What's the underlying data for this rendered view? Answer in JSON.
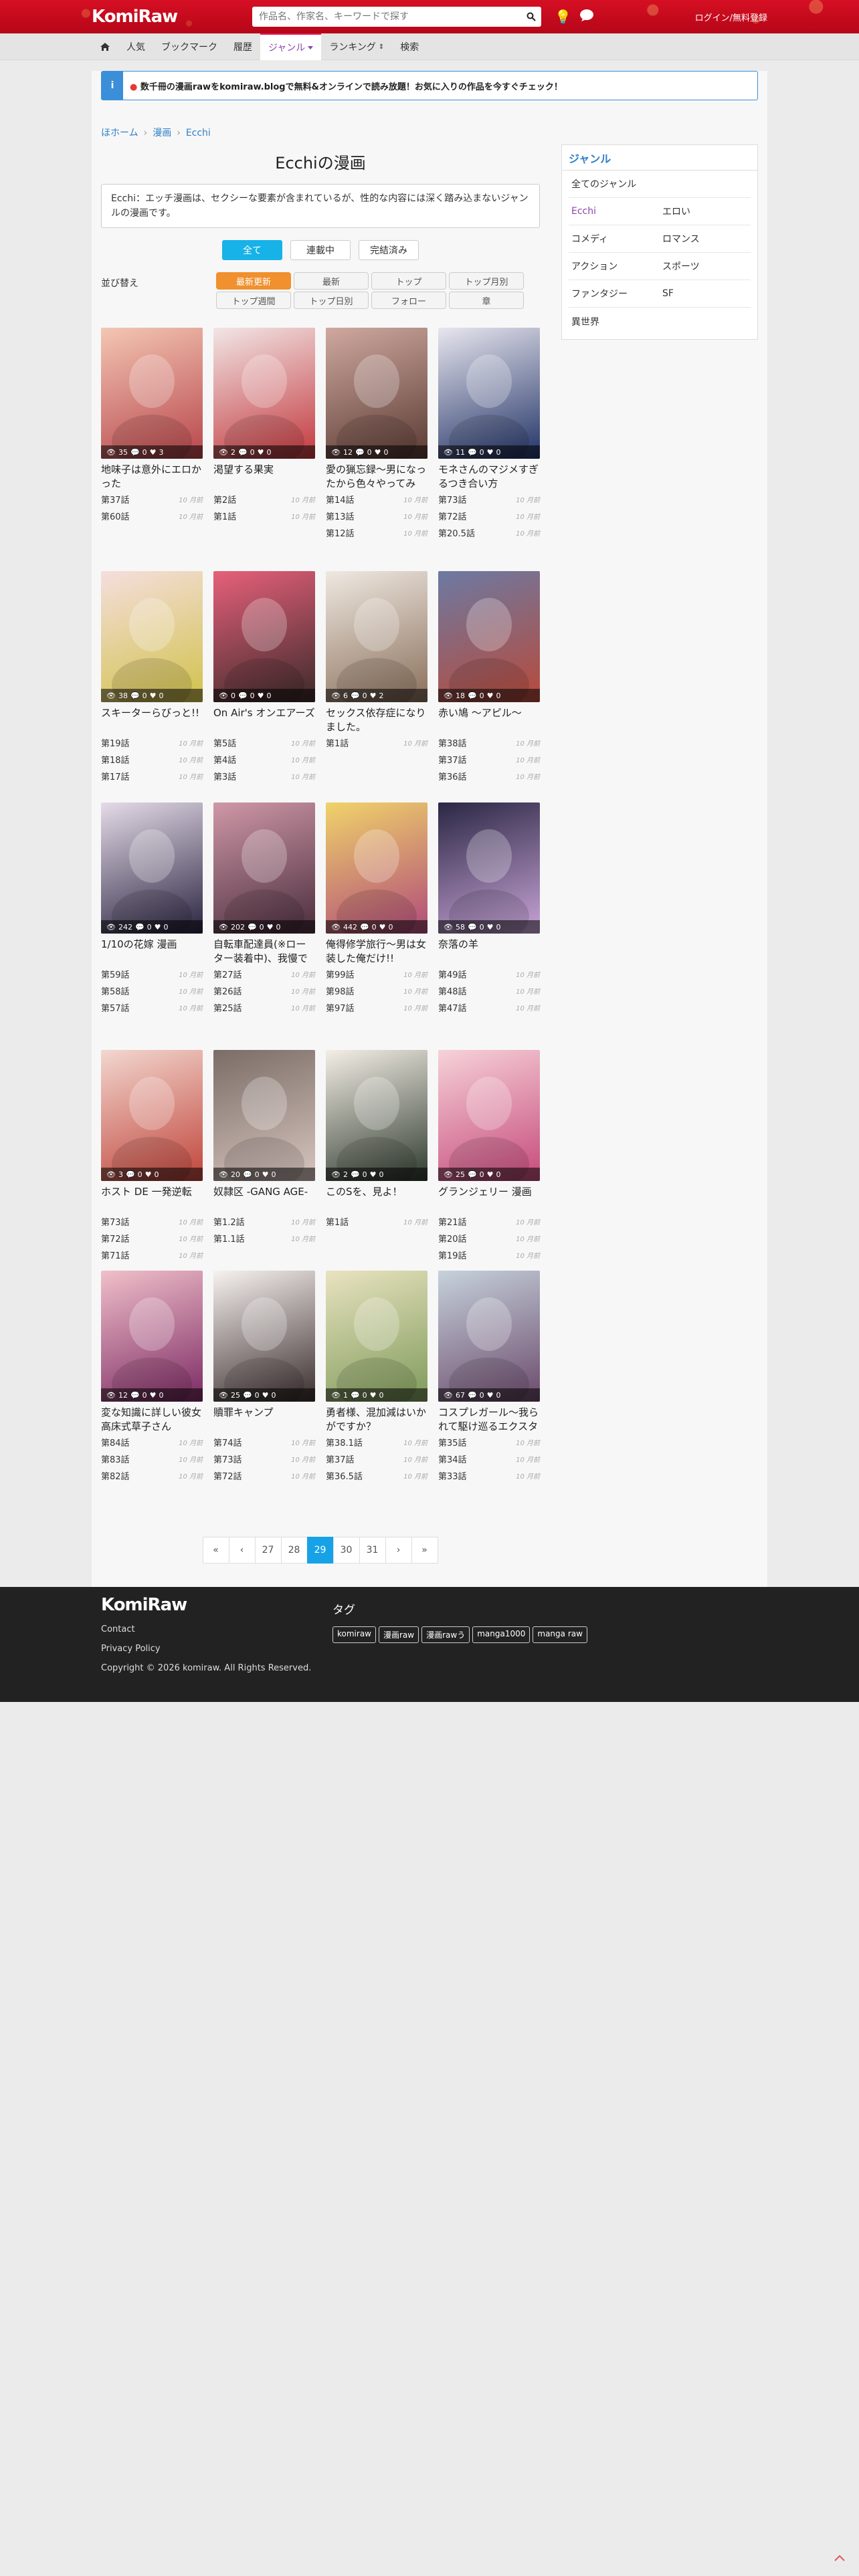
{
  "header": {
    "logo": "KomiRaw",
    "search_placeholder": "作品名、作家名、キーワードで探す",
    "login": "ログイン/無料登録"
  },
  "nav": {
    "home_icon": "home-icon",
    "items": [
      "人気",
      "ブックマーク",
      "履歴",
      "ジャンル",
      "ランキング",
      "検索"
    ]
  },
  "notice": {
    "icon_text": "i",
    "text": "数千冊の漫画rawをkomiraw.blogで無料&オンラインで読み放題！お気に入りの作品を今すぐチェック！"
  },
  "breadcrumb": [
    "ほホーム",
    "漫画",
    "Ecchi"
  ],
  "page": {
    "title": "Ecchiの漫画",
    "description": "Ecchi：エッチ漫画は、セクシーな要素が含まれているが、性的な内容には深く踏み込まないジャンルの漫画です。"
  },
  "status_tabs": [
    "全て",
    "連載中",
    "完結済み"
  ],
  "sort": {
    "label": "並び替え",
    "options": [
      "最新更新",
      "最新",
      "トップ",
      "トップ月別",
      "トップ週間",
      "トップ日別",
      "フォロー",
      "章"
    ]
  },
  "manga": [
    {
      "title": "地味子は意外にエロかった",
      "views": "35",
      "comments": "0",
      "likes": "3",
      "chapters": [
        {
          "ch": "第37話",
          "ago": "10 月前"
        },
        {
          "ch": "第60話",
          "ago": "10 月前"
        }
      ]
    },
    {
      "title": "渇望する果実",
      "views": "2",
      "comments": "0",
      "likes": "0",
      "chapters": [
        {
          "ch": "第2話",
          "ago": "10 月前"
        },
        {
          "ch": "第1話",
          "ago": "10 月前"
        }
      ]
    },
    {
      "title": "愛の猟忘録〜男になったから色々やってみた〜",
      "views": "12",
      "comments": "0",
      "likes": "0",
      "chapters": [
        {
          "ch": "第14話",
          "ago": "10 月前"
        },
        {
          "ch": "第13話",
          "ago": "10 月前"
        },
        {
          "ch": "第12話",
          "ago": "10 月前"
        }
      ]
    },
    {
      "title": "モネさんのマジメすぎるつき合い方",
      "views": "11",
      "comments": "0",
      "likes": "0",
      "chapters": [
        {
          "ch": "第73話",
          "ago": "10 月前"
        },
        {
          "ch": "第72話",
          "ago": "10 月前"
        },
        {
          "ch": "第20.5話",
          "ago": "10 月前"
        }
      ]
    },
    {
      "title": "スキーターらびっと!!",
      "views": "38",
      "comments": "0",
      "likes": "0",
      "chapters": [
        {
          "ch": "第19話",
          "ago": "10 月前"
        },
        {
          "ch": "第18話",
          "ago": "10 月前"
        },
        {
          "ch": "第17話",
          "ago": "10 月前"
        }
      ]
    },
    {
      "title": "On Air's オンエアーズ",
      "views": "0",
      "comments": "0",
      "likes": "0",
      "chapters": [
        {
          "ch": "第5話",
          "ago": "10 月前"
        },
        {
          "ch": "第4話",
          "ago": "10 月前"
        },
        {
          "ch": "第3話",
          "ago": "10 月前"
        }
      ]
    },
    {
      "title": "セックス依存症になりました。",
      "views": "6",
      "comments": "0",
      "likes": "2",
      "chapters": [
        {
          "ch": "第1話",
          "ago": "10 月前"
        }
      ]
    },
    {
      "title": "赤い鳩 〜アピル〜",
      "views": "18",
      "comments": "0",
      "likes": "0",
      "chapters": [
        {
          "ch": "第38話",
          "ago": "10 月前"
        },
        {
          "ch": "第37話",
          "ago": "10 月前"
        },
        {
          "ch": "第36話",
          "ago": "10 月前"
        }
      ]
    },
    {
      "title": "1/10の花嫁 漫画",
      "views": "242",
      "comments": "0",
      "likes": "0",
      "chapters": [
        {
          "ch": "第59話",
          "ago": "10 月前"
        },
        {
          "ch": "第58話",
          "ago": "10 月前"
        },
        {
          "ch": "第57話",
          "ago": "10 月前"
        }
      ]
    },
    {
      "title": "自転車配達員(※ローター装着中)、我慢できず外でイッちゃ…",
      "views": "202",
      "comments": "0",
      "likes": "0",
      "chapters": [
        {
          "ch": "第27話",
          "ago": "10 月前"
        },
        {
          "ch": "第26話",
          "ago": "10 月前"
        },
        {
          "ch": "第25話",
          "ago": "10 月前"
        }
      ]
    },
    {
      "title": "俺得修学旅行〜男は女装した俺だけ!!",
      "views": "442",
      "comments": "0",
      "likes": "0",
      "chapters": [
        {
          "ch": "第99話",
          "ago": "10 月前"
        },
        {
          "ch": "第98話",
          "ago": "10 月前"
        },
        {
          "ch": "第97話",
          "ago": "10 月前"
        }
      ]
    },
    {
      "title": "奈落の羊",
      "views": "58",
      "comments": "0",
      "likes": "0",
      "chapters": [
        {
          "ch": "第49話",
          "ago": "10 月前"
        },
        {
          "ch": "第48話",
          "ago": "10 月前"
        },
        {
          "ch": "第47話",
          "ago": "10 月前"
        }
      ]
    },
    {
      "title": "ホスト DE 一発逆転",
      "views": "3",
      "comments": "0",
      "likes": "0",
      "chapters": [
        {
          "ch": "第73話",
          "ago": "10 月前"
        },
        {
          "ch": "第72話",
          "ago": "10 月前"
        },
        {
          "ch": "第71話",
          "ago": "10 月前"
        }
      ]
    },
    {
      "title": "奴隷区 -GANG AGE-",
      "views": "20",
      "comments": "0",
      "likes": "0",
      "chapters": [
        {
          "ch": "第1.2話",
          "ago": "10 月前"
        },
        {
          "ch": "第1.1話",
          "ago": "10 月前"
        }
      ]
    },
    {
      "title": "このSを、見よ！",
      "views": "2",
      "comments": "0",
      "likes": "0",
      "chapters": [
        {
          "ch": "第1話",
          "ago": "10 月前"
        }
      ]
    },
    {
      "title": "グランジェリー 漫画",
      "views": "25",
      "comments": "0",
      "likes": "0",
      "chapters": [
        {
          "ch": "第21話",
          "ago": "10 月前"
        },
        {
          "ch": "第20話",
          "ago": "10 月前"
        },
        {
          "ch": "第19話",
          "ago": "10 月前"
        }
      ]
    },
    {
      "title": "変な知識に詳しい彼女 高床式草子さん",
      "views": "12",
      "comments": "0",
      "likes": "0",
      "chapters": [
        {
          "ch": "第84話",
          "ago": "10 月前"
        },
        {
          "ch": "第83話",
          "ago": "10 月前"
        },
        {
          "ch": "第82話",
          "ago": "10 月前"
        }
      ]
    },
    {
      "title": "贖罪キャンプ",
      "views": "25",
      "comments": "0",
      "likes": "0",
      "chapters": [
        {
          "ch": "第74話",
          "ago": "10 月前"
        },
        {
          "ch": "第73話",
          "ago": "10 月前"
        },
        {
          "ch": "第72話",
          "ago": "10 月前"
        }
      ]
    },
    {
      "title": "勇者様、混加減はいかがですか？",
      "views": "1",
      "comments": "0",
      "likes": "0",
      "chapters": [
        {
          "ch": "第38.1話",
          "ago": "10 月前"
        },
        {
          "ch": "第37話",
          "ago": "10 月前"
        },
        {
          "ch": "第36.5話",
          "ago": "10 月前"
        }
      ]
    },
    {
      "title": "コスプレガール〜我られて駆け巡るエクスタシー〜",
      "views": "67",
      "comments": "0",
      "likes": "0",
      "chapters": [
        {
          "ch": "第35話",
          "ago": "10 月前"
        },
        {
          "ch": "第34話",
          "ago": "10 月前"
        },
        {
          "ch": "第33話",
          "ago": "10 月前"
        }
      ]
    }
  ],
  "pagination": [
    "«",
    "‹",
    "27",
    "28",
    "29",
    "30",
    "31",
    "›",
    "»"
  ],
  "sidebar": {
    "heading": "ジャンル",
    "all": "全てのジャンル",
    "genres": [
      "Ecchi",
      "エロい",
      "コメディ",
      "ロマンス",
      "アクション",
      "スポーツ",
      "ファンタジー",
      "SF",
      "異世界"
    ]
  },
  "footer": {
    "logo": "KomiRaw",
    "links": [
      "Contact",
      "Privacy Policy"
    ],
    "copyright": "Copyright © 2026 komiraw. All Rights Reserved.",
    "tag_heading": "タグ",
    "tags": [
      "komiraw",
      "漫画raw",
      "漫画rawう",
      "manga1000",
      "manga raw"
    ]
  },
  "colors": {
    "header_red": "#c8091d",
    "active_tab": "#17b2e8",
    "active_sort": "#f0902e",
    "link_blue": "#2f80c7",
    "genre_active": "#8e44ad"
  }
}
